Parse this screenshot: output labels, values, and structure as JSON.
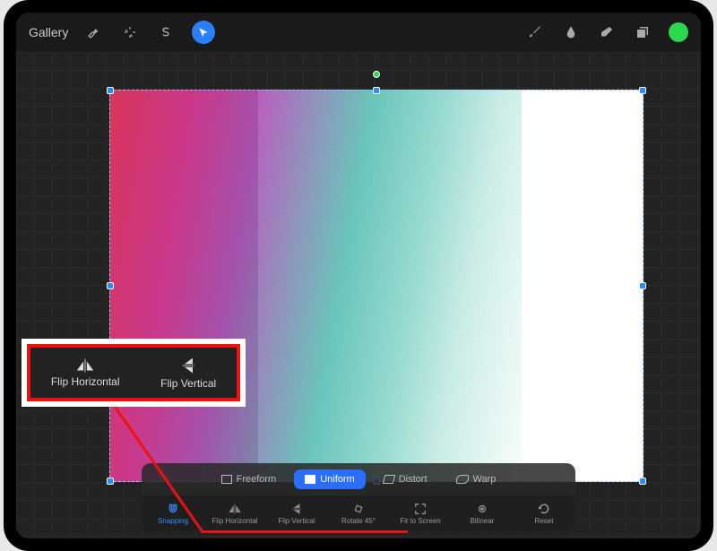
{
  "topbar": {
    "gallery": "Gallery"
  },
  "modes": {
    "freeform": "Freeform",
    "uniform": "Uniform",
    "distort": "Distort",
    "warp": "Warp"
  },
  "toolbar": {
    "snapping": "Snapping",
    "flip_h": "Flip Horizontal",
    "flip_v": "Flip Vertical",
    "rotate": "Rotate 45°",
    "fit": "Fit to Screen",
    "bilinear": "Bilinear",
    "reset": "Reset"
  },
  "callout": {
    "flip_h": "Flip Horizontal",
    "flip_v": "Flip Vertical"
  }
}
